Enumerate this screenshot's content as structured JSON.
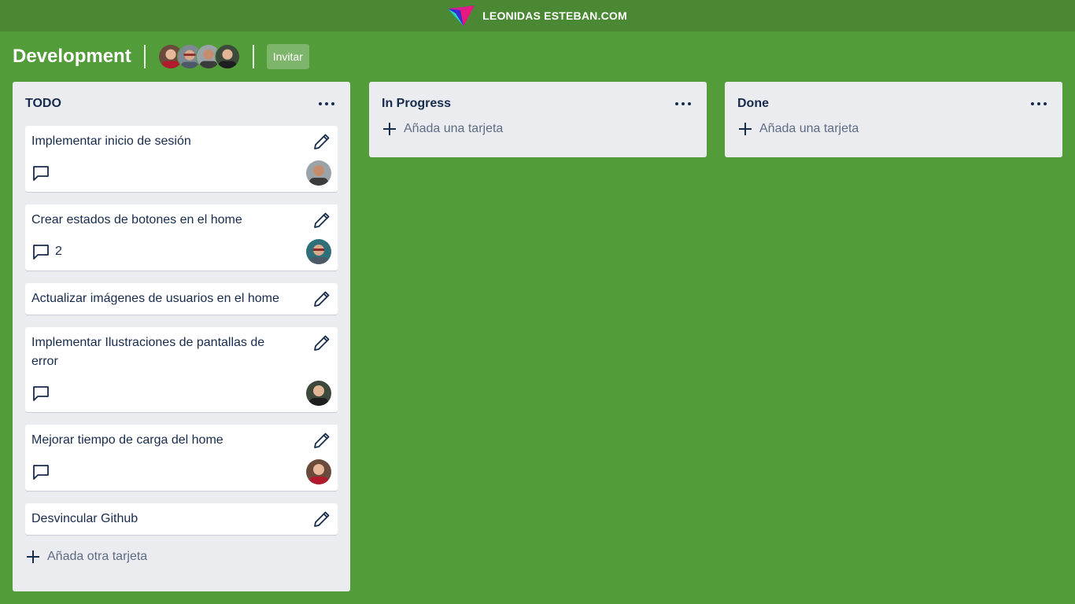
{
  "topbar": {
    "brand": "LEONIDAS ESTEBAN.COM"
  },
  "board": {
    "title": "Development",
    "invite_label": "Invitar",
    "members": [
      "member-1",
      "member-2",
      "member-3",
      "member-4"
    ]
  },
  "lists": [
    {
      "title": "TODO",
      "cards": [
        {
          "title": "Implementar inicio de sesión",
          "comments": "",
          "has_footer": true
        },
        {
          "title": "Crear estados de botones en el home",
          "comments": "2",
          "has_footer": true
        },
        {
          "title": "Actualizar imágenes de usuarios en el home",
          "comments": "",
          "has_footer": false
        },
        {
          "title": "Implementar Ilustraciones de pantallas de error",
          "comments": "",
          "has_footer": true
        },
        {
          "title": "Mejorar tiempo de carga del home",
          "comments": "",
          "has_footer": true
        },
        {
          "title": "Desvincular Github",
          "comments": "",
          "has_footer": false
        }
      ],
      "add_label": "Añada otra tarjeta"
    },
    {
      "title": "In Progress",
      "cards": [],
      "add_label": "Añada una tarjeta"
    },
    {
      "title": "Done",
      "cards": [],
      "add_label": "Añada una tarjeta"
    }
  ],
  "icons": {
    "more": "more-horizontal-icon",
    "edit": "pencil-icon",
    "comment": "speech-bubble-icon",
    "add": "plus-icon"
  },
  "colors": {
    "background": "#529c3a",
    "topbar": "#4a8834",
    "list": "#ebecf0",
    "card": "#ffffff",
    "text": "#172b4d",
    "muted": "#5e6c84"
  }
}
